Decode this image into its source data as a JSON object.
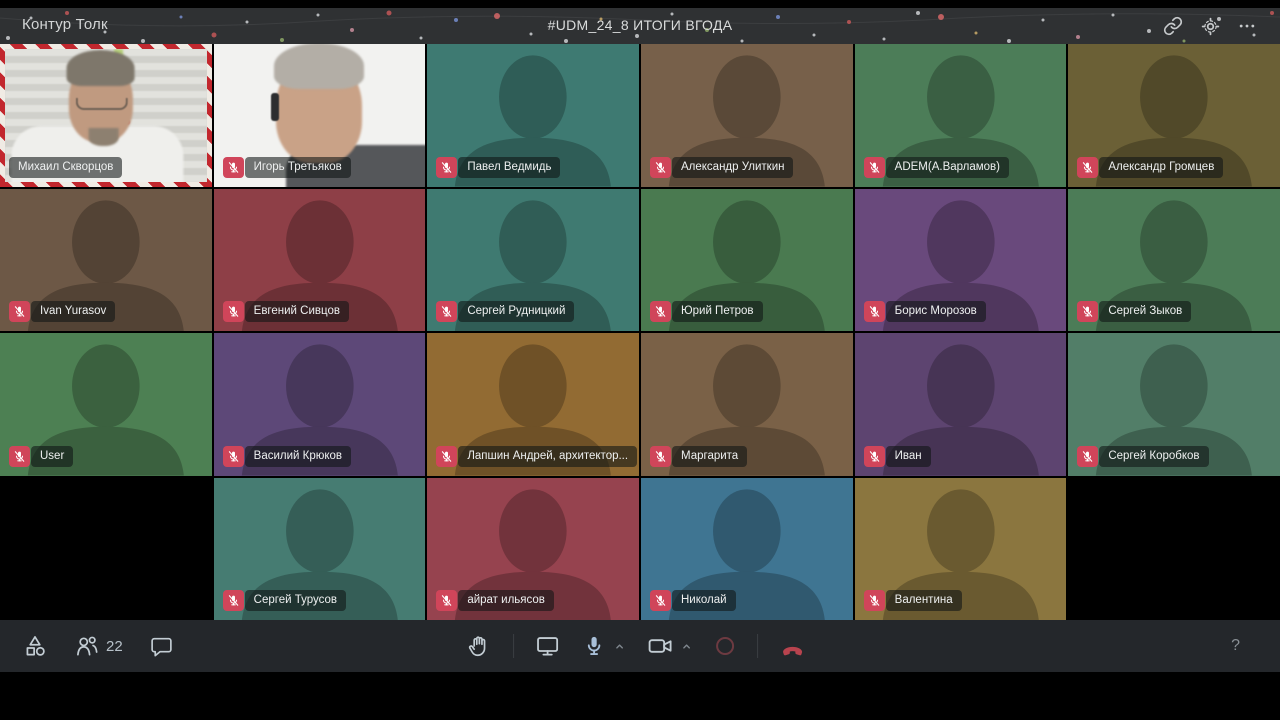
{
  "window": {
    "app_name": "Контур Толк",
    "meeting_title": "#UDM_24_8 ИТОГИ ВГОДА"
  },
  "participants": [
    {
      "name": "Михаил Скворцов",
      "row": 1,
      "col": 1,
      "muted": false,
      "video": "photo-speaker",
      "speaking": true
    },
    {
      "name": "Игорь Третьяков",
      "row": 1,
      "col": 2,
      "muted": true,
      "video": "photo-headset"
    },
    {
      "name": "Павел Ведмидь",
      "row": 1,
      "col": 3,
      "muted": true,
      "color": "#3E7A72"
    },
    {
      "name": "Александр Улиткин",
      "row": 1,
      "col": 4,
      "muted": true,
      "color": "#77604A"
    },
    {
      "name": "ADEM(А.Варламов)",
      "row": 1,
      "col": 5,
      "muted": true,
      "color": "#4C7D58"
    },
    {
      "name": "Александр Громцев",
      "row": 1,
      "col": 6,
      "muted": true,
      "color": "#6B6036"
    },
    {
      "name": "Ivan Yurasov",
      "row": 2,
      "col": 1,
      "muted": true,
      "color": "#6D5846"
    },
    {
      "name": "Евгений Сивцов",
      "row": 2,
      "col": 2,
      "muted": true,
      "color": "#8E3F47"
    },
    {
      "name": "Сергей Рудницкий",
      "row": 2,
      "col": 3,
      "muted": true,
      "color": "#3F7A71"
    },
    {
      "name": "Юрий Петров",
      "row": 2,
      "col": 4,
      "muted": true,
      "color": "#4A7A50"
    },
    {
      "name": "Борис Морозов",
      "row": 2,
      "col": 5,
      "muted": true,
      "color": "#69497C"
    },
    {
      "name": "Сергей Зыков",
      "row": 2,
      "col": 6,
      "muted": true,
      "color": "#4C7C57"
    },
    {
      "name": "User",
      "row": 3,
      "col": 1,
      "muted": true,
      "color": "#4D8053"
    },
    {
      "name": "Василий Крюков",
      "row": 3,
      "col": 2,
      "muted": true,
      "color": "#5D4878"
    },
    {
      "name": "Лапшин Андрей, архитектор...",
      "row": 3,
      "col": 3,
      "muted": true,
      "color": "#926B33"
    },
    {
      "name": "Маргарита",
      "row": 3,
      "col": 4,
      "muted": true,
      "color": "#7A6147"
    },
    {
      "name": "Иван",
      "row": 3,
      "col": 5,
      "muted": true,
      "color": "#5D4470"
    },
    {
      "name": "Сергей Коробков",
      "row": 3,
      "col": 6,
      "muted": true,
      "color": "#527E68"
    },
    {
      "name": "Сергей Турусов",
      "row": 4,
      "col": 2,
      "muted": true,
      "color": "#467C72"
    },
    {
      "name": "айрат ильясов",
      "row": 4,
      "col": 3,
      "muted": true,
      "color": "#96434F"
    },
    {
      "name": "Николай",
      "row": 4,
      "col": 4,
      "muted": true,
      "color": "#3F7592"
    },
    {
      "name": "Валентина",
      "row": 4,
      "col": 5,
      "muted": true,
      "color": "#8B763F"
    }
  ],
  "toolbar": {
    "participants_count": "22",
    "help_label": "?"
  },
  "colors": {
    "mute_badge": "#D0455A",
    "top_bar": "#2F3133",
    "toolbar_bg": "#24272B",
    "stripe_red": "#C2272E",
    "stripe_white": "#F0EBE4",
    "hangup_red": "#B8434E",
    "record_red": "#6D3A41",
    "mic_fill": "#A8BFD8",
    "icon_gray": "#C3CDD4"
  }
}
